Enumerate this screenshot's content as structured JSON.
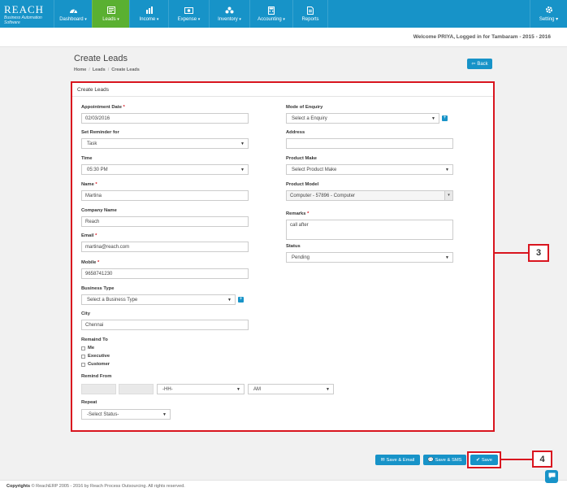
{
  "brand": {
    "logo": "REACH",
    "tagline": "Business Automation Software"
  },
  "nav": [
    {
      "label": "Dashboard",
      "icon": "dashboard-icon",
      "active": false
    },
    {
      "label": "Leads",
      "icon": "leads-icon",
      "active": true
    },
    {
      "label": "Income",
      "icon": "income-icon",
      "active": false
    },
    {
      "label": "Expense",
      "icon": "expense-icon",
      "active": false
    },
    {
      "label": "Inventory",
      "icon": "inventory-icon",
      "active": false
    },
    {
      "label": "Accounting",
      "icon": "accounting-icon",
      "active": false
    },
    {
      "label": "Reports",
      "icon": "reports-icon",
      "active": false
    }
  ],
  "setting_label": "Setting",
  "welcome": "Welcome PRIYA, Logged in for Tambaram - 2015 - 2016",
  "page_title": "Create Leads",
  "breadcrumb": [
    "Home",
    "Leads",
    "Create Leads"
  ],
  "back_label": "Back",
  "panel_title": "Create Leads",
  "form": {
    "appointment_date": {
      "label": "Appointment Date",
      "value": "02/03/2016"
    },
    "set_reminder": {
      "label": "Set Reminder for",
      "value": "Task"
    },
    "time": {
      "label": "Time",
      "value": "05:30 PM"
    },
    "name": {
      "label": "Name",
      "value": "Martina"
    },
    "company": {
      "label": "Company Name",
      "value": "Reach"
    },
    "email": {
      "label": "Email",
      "value": "martina@reach.com"
    },
    "mobile": {
      "label": "Mobile",
      "value": "9658741230"
    },
    "business_type": {
      "label": "Business Type",
      "value": "Select a Business Type"
    },
    "city": {
      "label": "City",
      "value": "Chennai"
    },
    "remaind_to": {
      "label": "Remaind To",
      "options": [
        "Me",
        "Executive",
        "Customer"
      ]
    },
    "remind_from": {
      "label": "Remind From",
      "hh": "-HH-",
      "ampm": "AM"
    },
    "repeat": {
      "label": "Repeat",
      "value": "-Select Status-"
    },
    "mode_enquiry": {
      "label": "Mode of Enquiry",
      "value": "Select a Enquiry"
    },
    "address": {
      "label": "Address",
      "value": ""
    },
    "product_make": {
      "label": "Product Make",
      "value": "Select Product Make"
    },
    "product_model": {
      "label": "Product Model",
      "value": "Computer - 57896 - Computer"
    },
    "remarks": {
      "label": "Remarks",
      "value": "call after"
    },
    "status": {
      "label": "Status",
      "value": "Pending"
    }
  },
  "buttons": {
    "save_email": "Save & Email",
    "save_sms": "Save & SMS",
    "save": "Save"
  },
  "markers": {
    "m3": "3",
    "m4": "4"
  },
  "footer": {
    "bold": "Copyrights",
    "text": "© ReachERP 2005 - 2016 by Reach Process Outsourcing. All rights reserved."
  },
  "colors": {
    "primary": "#1793c8",
    "active": "#5ab031",
    "highlight": "#d9151f"
  }
}
